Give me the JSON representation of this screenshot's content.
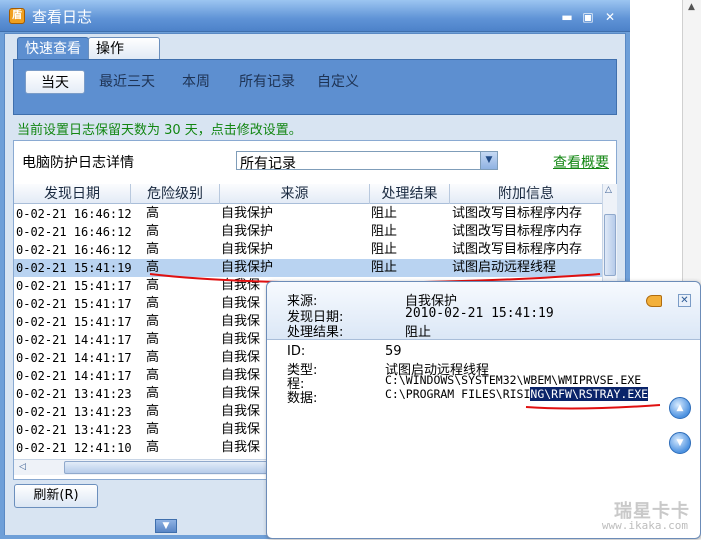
{
  "window": {
    "title": "查看日志",
    "title_icon": "shield-icon",
    "controls": [
      "minimize-icon",
      "maximize-icon",
      "close-icon"
    ]
  },
  "tabs": [
    "快速查看",
    "操作"
  ],
  "active_tab": "快速查看",
  "subtabs": [
    "当天",
    "最近三天",
    "本周",
    "所有记录",
    "自定义"
  ],
  "notice": "当前设置日志保留天数为 30 天，点击修改设置。",
  "panel": {
    "label": "电脑防护日志详情",
    "filter_value": "所有记录",
    "overview_link": "查看概要"
  },
  "table": {
    "columns": [
      "发现日期",
      "危险级别",
      "来源",
      "处理结果",
      "附加信息"
    ],
    "rows": [
      {
        "date": "0-02-21 16:46:12",
        "level": "高",
        "source": "自我保护",
        "result": "阻止",
        "info": "试图改写目标程序内存"
      },
      {
        "date": "0-02-21 16:46:12",
        "level": "高",
        "source": "自我保护",
        "result": "阻止",
        "info": "试图改写目标程序内存"
      },
      {
        "date": "0-02-21 16:46:12",
        "level": "高",
        "source": "自我保护",
        "result": "阻止",
        "info": "试图改写目标程序内存"
      },
      {
        "date": "0-02-21 15:41:19",
        "level": "高",
        "source": "自我保护",
        "result": "阻止",
        "info": "试图启动远程线程"
      },
      {
        "date": "0-02-21 15:41:17",
        "level": "高",
        "source": "自我保"
      },
      {
        "date": "0-02-21 15:41:17",
        "level": "高",
        "source": "自我保"
      },
      {
        "date": "0-02-21 15:41:17",
        "level": "高",
        "source": "自我保"
      },
      {
        "date": "0-02-21 14:41:17",
        "level": "高",
        "source": "自我保"
      },
      {
        "date": "0-02-21 14:41:17",
        "level": "高",
        "source": "自我保"
      },
      {
        "date": "0-02-21 14:41:17",
        "level": "高",
        "source": "自我保"
      },
      {
        "date": "0-02-21 13:41:23",
        "level": "高",
        "source": "自我保"
      },
      {
        "date": "0-02-21 13:41:23",
        "level": "高",
        "source": "自我保"
      },
      {
        "date": "0-02-21 13:41:23",
        "level": "高",
        "source": "自我保"
      },
      {
        "date": "0-02-21 12:41:10",
        "level": "高",
        "source": "自我保"
      }
    ],
    "selected_index": 3
  },
  "refresh_button": "刷新(R)",
  "popup": {
    "source_label": "来源:",
    "source_value": "自我保护",
    "date_label": "发现日期:",
    "date_value": "2010-02-21 15:41:19",
    "result_label": "处理结果:",
    "result_value": "阻止",
    "id_label": "ID:",
    "id_value": "59",
    "type_label": "类型:",
    "type_value": "试图启动远程线程",
    "proc_label": "程:",
    "proc_value": "C:\\WINDOWS\\SYSTEM32\\WBEM\\WMIPRVSE.EXE",
    "data_label": "数据:",
    "data_value_plain": "C:\\PROGRAM FILES\\RISI",
    "data_value_selected": "NG\\RFW\\RSTRAY.EXE"
  },
  "watermark": {
    "logo": "瑞星卡卡",
    "url": "www.ikaka.com"
  },
  "colors": {
    "titlebar": "#5f93d6",
    "panel_blue": "#5d8fd0",
    "notice_green": "#128612",
    "selected_row": "#b9d3f1",
    "annotation_red": "#e01010"
  }
}
